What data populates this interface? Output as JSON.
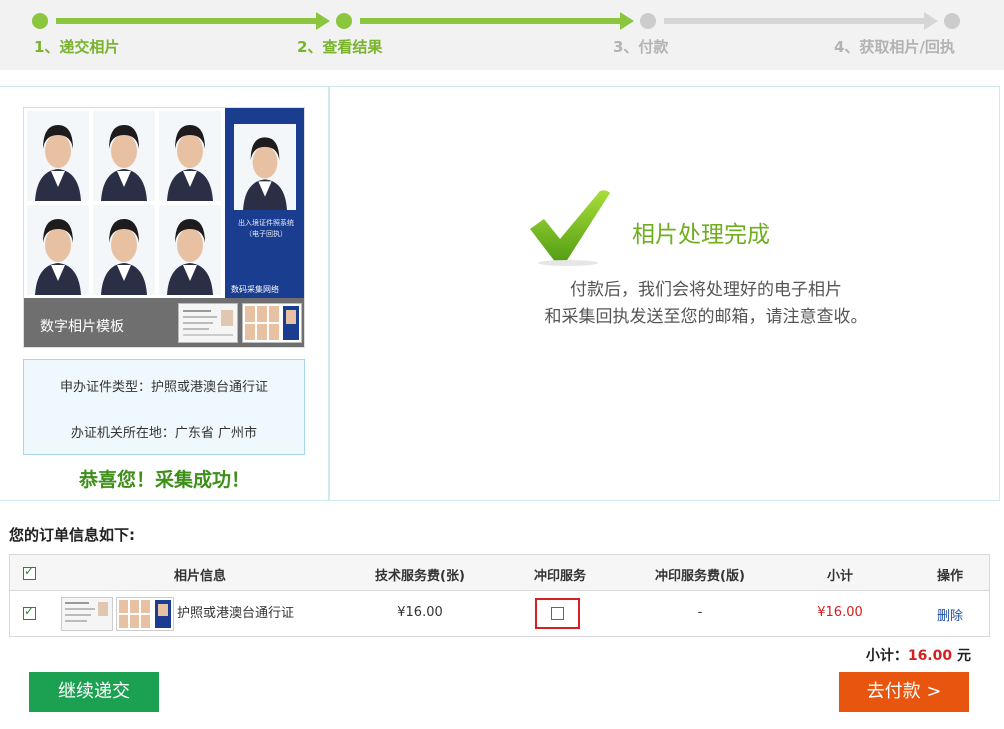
{
  "progress": {
    "steps": [
      {
        "label": "1、递交相片",
        "state": "done"
      },
      {
        "label": "2、查看结果",
        "state": "done"
      },
      {
        "label": "3、付款",
        "state": "todo"
      },
      {
        "label": "4、获取相片/回执",
        "state": "todo"
      }
    ]
  },
  "left_panel": {
    "template_label": "数字相片模板",
    "template_caption": "出入境证件照系统",
    "template_sub": "（电子回执）",
    "template_logo": "数码采集网络",
    "doc_type": "申办证件类型：护照或港澳台通行证",
    "office_location": "办证机关所在地：广东省  广州市",
    "congrats": "恭喜您！采集成功！"
  },
  "result": {
    "title": "相片处理完成",
    "message_line1": "付款后，我们会将处理好的电子相片",
    "message_line2": "和采集回执发送至您的邮箱，请注意查收。"
  },
  "order": {
    "title": "您的订单信息如下:",
    "headers": {
      "photo_info": "相片信息",
      "tech_fee": "技术服务费(张)",
      "print_service": "冲印服务",
      "print_fee": "冲印服务费(版)",
      "subtotal": "小计",
      "actions": "操作"
    },
    "rows": [
      {
        "name": "护照或港澳台通行证",
        "tech_fee": "¥16.00",
        "print_fee": "-",
        "subtotal": "¥16.00",
        "delete": "删除"
      }
    ],
    "total_label": "小计：",
    "total_amount": "16.00",
    "total_unit": " 元"
  },
  "buttons": {
    "continue": "继续递交",
    "pay": "去付款 >"
  },
  "colors": {
    "progress_done": "#8cc63f",
    "progress_todo": "#d6d6d6",
    "price": "#d42020",
    "continue_button": "#1ca152",
    "pay_button": "#e8550e"
  }
}
